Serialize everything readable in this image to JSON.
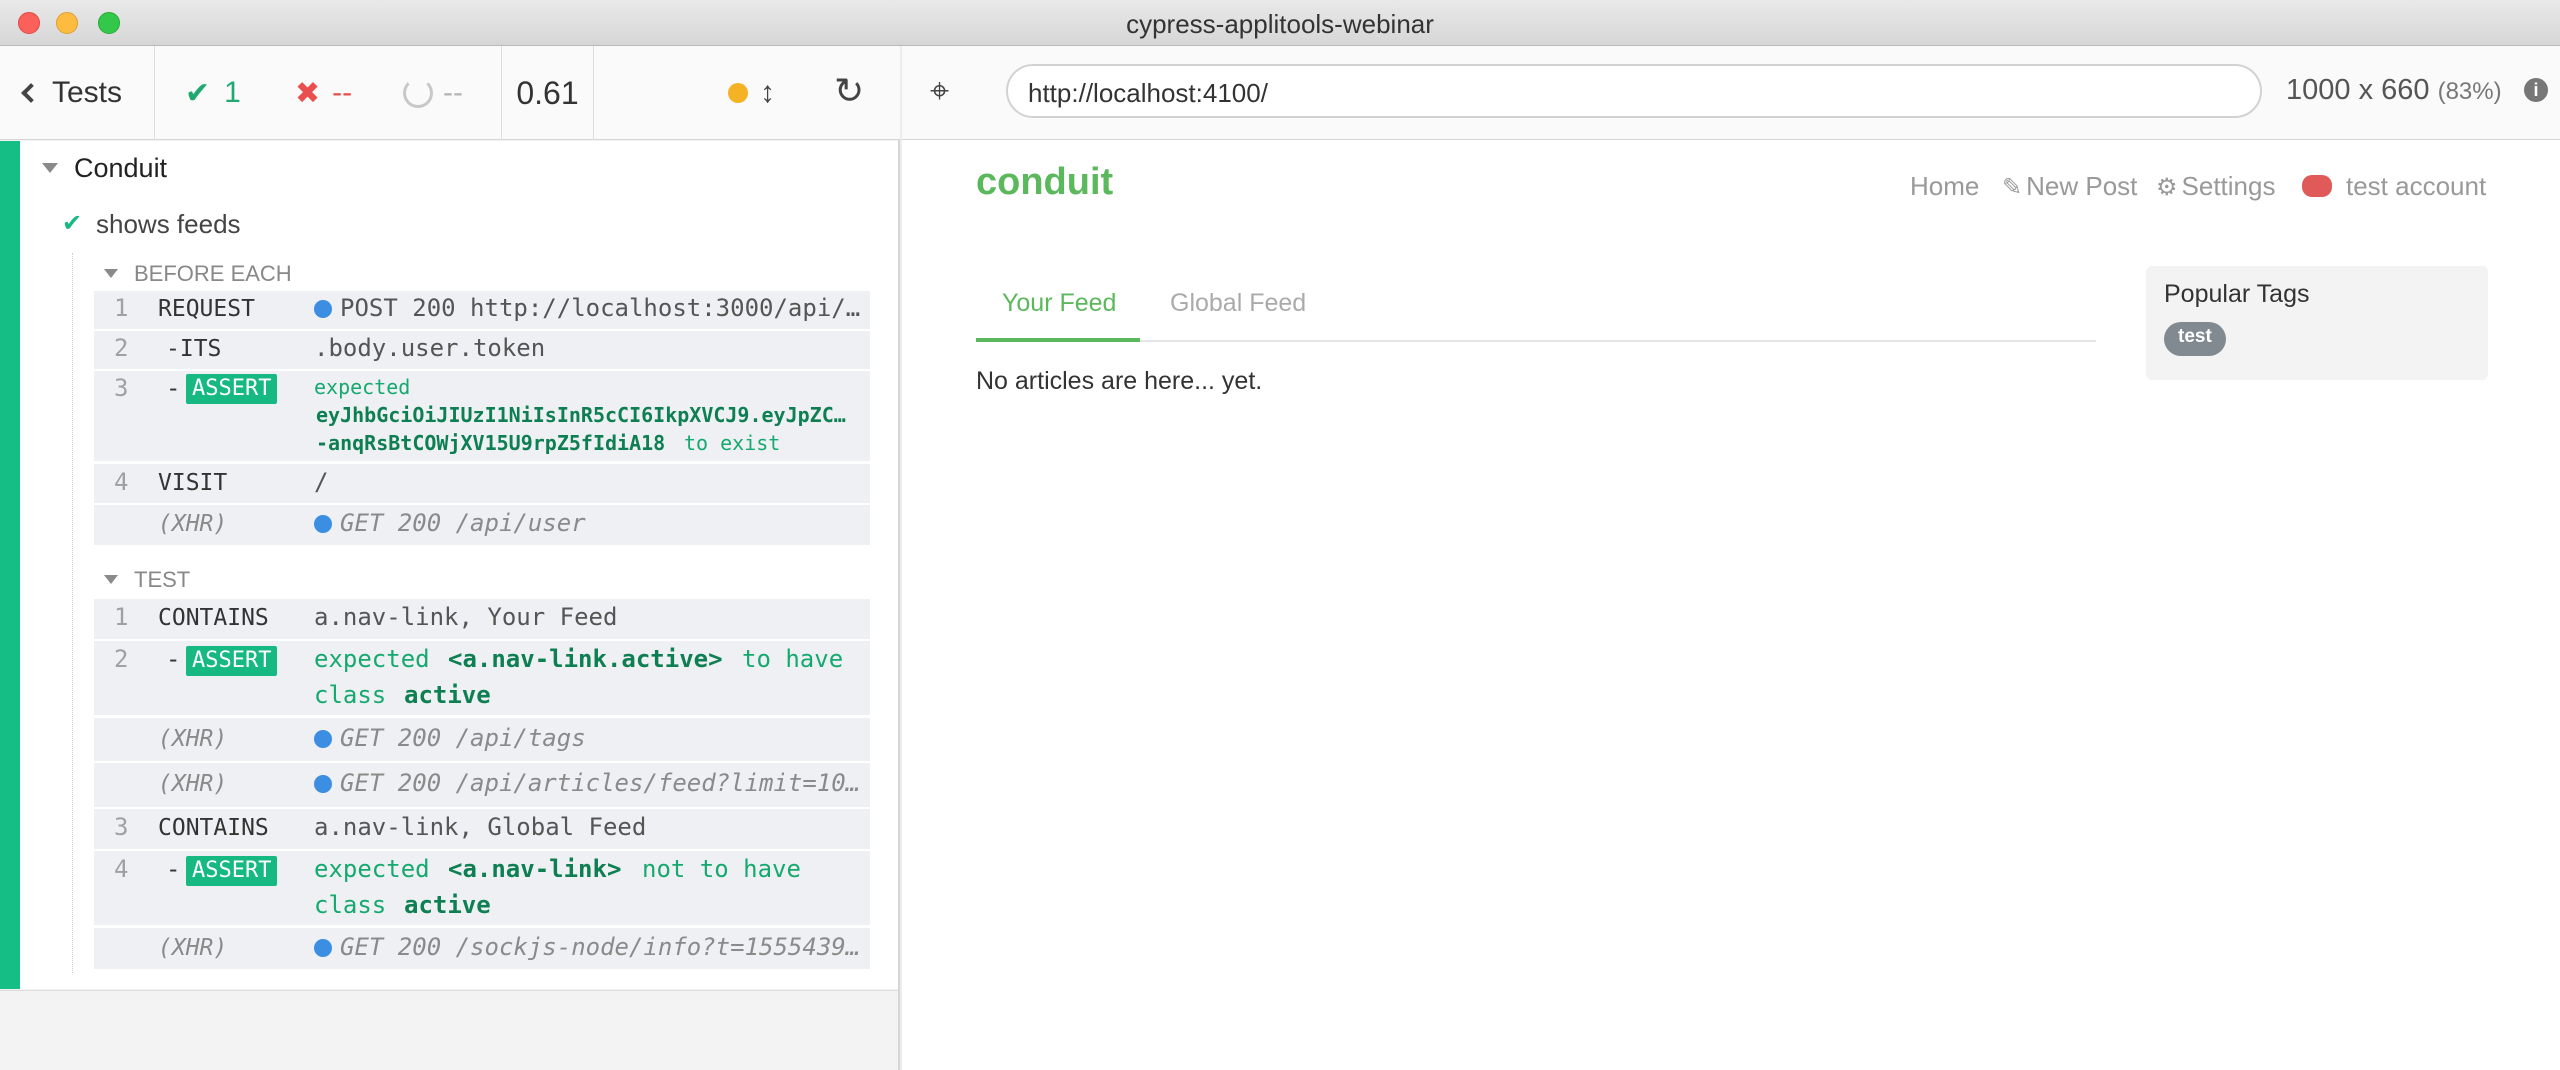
{
  "window": {
    "title": "cypress-applitools-webinar"
  },
  "reporter": {
    "back_label": "Tests",
    "stats": {
      "passed": "1",
      "failed": "--",
      "pending": "--"
    },
    "duration": "0.61",
    "suite_title": "Conduit",
    "test_title": "shows feeds",
    "hooks": [
      {
        "title": "BEFORE EACH",
        "commands": [
          {
            "num": "1",
            "name": "REQUEST",
            "message": "POST 200 http://localhost:3000/api/…"
          },
          {
            "num": "2",
            "name": "-ITS",
            "message": ".body.user.token"
          },
          {
            "num": "3",
            "name": "ASSERT",
            "message_parts": [
              "expected",
              "eyJhbGciOiJIUzI1NiIsInR5cCI6IkpXVCJ9.eyJpZC…",
              "-anqRsBtCOWjXV15U9rpZ5fIdiA18",
              "to exist"
            ]
          },
          {
            "num": "4",
            "name": "VISIT",
            "message": "/"
          },
          {
            "num": "",
            "name": "(XHR)",
            "message": "GET 200 /api/user"
          }
        ]
      },
      {
        "title": "TEST",
        "commands": [
          {
            "num": "1",
            "name": "CONTAINS",
            "message": "a.nav-link, Your Feed"
          },
          {
            "num": "2",
            "name": "ASSERT",
            "message_parts": [
              "expected",
              "<a.nav-link.active>",
              "to have",
              "class",
              "active"
            ]
          },
          {
            "num": "",
            "name": "(XHR)",
            "message": "GET 200 /api/tags"
          },
          {
            "num": "",
            "name": "(XHR)",
            "message": "GET 200 /api/articles/feed?limit=10…"
          },
          {
            "num": "3",
            "name": "CONTAINS",
            "message": "a.nav-link, Global Feed"
          },
          {
            "num": "4",
            "name": "ASSERT",
            "message_parts": [
              "expected",
              "<a.nav-link>",
              "not to have",
              "class",
              "active"
            ]
          },
          {
            "num": "",
            "name": "(XHR)",
            "message": "GET 200 /sockjs-node/info?t=1555439…"
          }
        ]
      }
    ]
  },
  "aut": {
    "url": "http://localhost:4100/",
    "viewport": "1000 x 660",
    "zoom": "(83%)",
    "app": {
      "brand": "conduit",
      "nav": {
        "home": "Home",
        "new_post": "New Post",
        "settings": "Settings",
        "user": "test account"
      },
      "tabs": {
        "your_feed": "Your Feed",
        "global_feed": "Global Feed"
      },
      "empty_message": "No articles are here... yet.",
      "sidebar": {
        "title": "Popular Tags",
        "tags": [
          "test"
        ]
      }
    },
    "colors": {
      "brand": "#5cb85c",
      "passed": "#1fa971",
      "failed": "#e94f4f"
    }
  }
}
